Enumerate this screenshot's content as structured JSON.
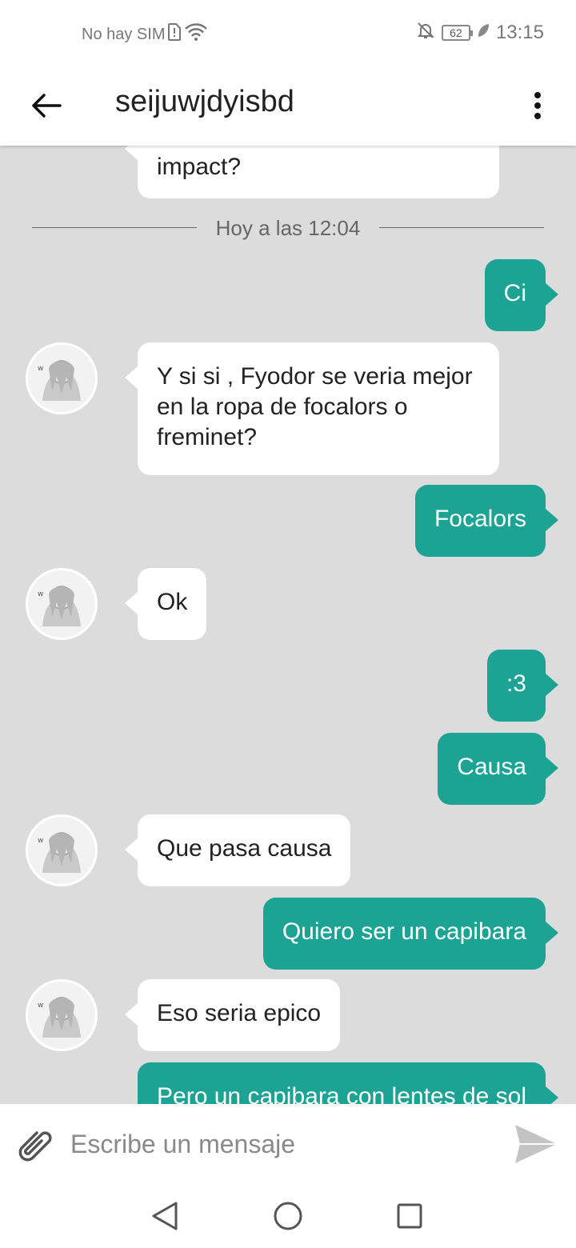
{
  "status_bar": {
    "carrier": "No hay SIM",
    "battery": "62",
    "time": "13:15"
  },
  "header": {
    "title": "seijuwjdyisbd"
  },
  "divider": {
    "label": "Hoy a las 12:04"
  },
  "messages": [
    {
      "from": "other",
      "text": "impact?",
      "partial": true
    },
    {
      "from": "me",
      "text": "Ci"
    },
    {
      "from": "other",
      "text": "Y si si , Fyodor se veria mejor en la ropa de focalors o freminet?"
    },
    {
      "from": "me",
      "text": "Focalors"
    },
    {
      "from": "other",
      "text": "Ok"
    },
    {
      "from": "me",
      "text": ":3"
    },
    {
      "from": "me",
      "text": "Causa"
    },
    {
      "from": "other",
      "text": "Que pasa causa"
    },
    {
      "from": "me",
      "text": "Quiero ser un capibara"
    },
    {
      "from": "other",
      "text": "Eso seria epico"
    },
    {
      "from": "me",
      "text": "Pero un capibara con lentes de sol",
      "partial": true
    }
  ],
  "composer": {
    "placeholder": "Escribe un mensaje"
  },
  "colors": {
    "sent_bubble": "#1ca393",
    "received_bubble": "#ffffff",
    "chat_background": "#dcdcdc"
  }
}
